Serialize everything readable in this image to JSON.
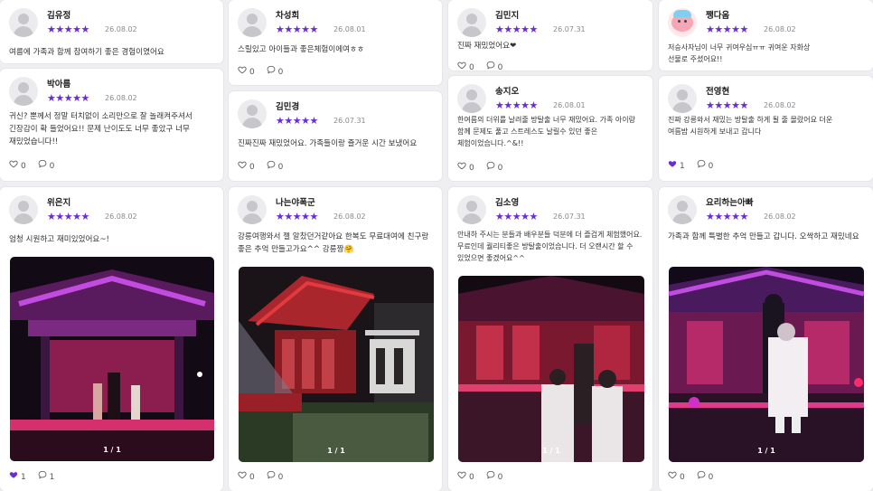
{
  "icons": {
    "like": "heart-icon",
    "comment": "comment-icon"
  },
  "colors": {
    "star": "#6a2bd9",
    "liked": "#6a2bd9",
    "background": "#efeff2"
  },
  "rating_stars": "★★★★★",
  "reviews": [
    {
      "name": "김유정",
      "date": "26.08.02",
      "text": "여름에 가족과 함께 참여하기 좋은 경험이였어요",
      "likes": "0",
      "comments": "0"
    },
    {
      "name": "박아름",
      "date": "26.08.02",
      "text": "귀신? 뿐께서 정말 터치없이 소리만으로 잘 놀래켜주셔서 긴장감이 확 들었어요!! 문제 난이도도 너무 좋았구 너무 재밌었습니다!!",
      "likes": "0",
      "comments": "0"
    },
    {
      "name": "위은지",
      "date": "26.08.02",
      "text": "엄청 시원하고 재미있었어요~!",
      "likes": "1",
      "comments": "1",
      "pager": "1 / 1"
    },
    {
      "name": "차성희",
      "date": "26.08.01",
      "text": "스릴있고 아이들과 좋은체험이에여ㅎㅎ",
      "likes": "0",
      "comments": "0"
    },
    {
      "name": "김민경",
      "date": "26.07.31",
      "text": "진짜진짜 재밌었어요. 가족들이랑 즐거운 시간 보냈어요",
      "likes": "0",
      "comments": "0"
    },
    {
      "name": "나는야폭군",
      "date": "26.08.02",
      "text": "강릉여행와서 젤 알찼던거같아요 한복도 무료대여에 친구랑 좋은 추억 만들고가요^^ 강릉짱🤗",
      "likes": "0",
      "comments": "0",
      "pager": "1 / 1"
    },
    {
      "name": "김민지",
      "date": "26.07.31",
      "text": "진짜 재밌었어요❤",
      "likes": "0",
      "comments": "0"
    },
    {
      "name": "송지오",
      "date": "26.08.01",
      "text": "한여름의 더위를 날려줄 방탈출 너무 재밌어요. 가족 아이랑 함께 문제도 풀고 스트레스도 날릴수 있던 좋은 체험이었습니다.^&!!",
      "likes": "0",
      "comments": "0"
    },
    {
      "name": "김소영",
      "date": "26.07.31",
      "text": "안내하 주시는 분들과 배우분들 덕분에 더 즐겁게 체험했어요. 무료인데 퀄리티좋은 방탈출이었습니다. 더 오랜시간 할 수 있었으면 좋겠어요^^",
      "likes": "0",
      "comments": "0",
      "pager": "1 / 1"
    },
    {
      "name": "쨍다옴",
      "date": "26.08.02",
      "text": "저승사자님이 너무 귀여우심ㅠㅠ 귀여운 자화상 선물로 주셨어요!!",
      "likes": "",
      "comments": ""
    },
    {
      "name": "전영현",
      "date": "26.08.02",
      "text": "진짜 강릉와서 재밌는 방탈출 하게 될 줄 몰랐어요 더운 여름밤 시원하게 보내고 갑니다",
      "likes": "1",
      "comments": "0"
    },
    {
      "name": "요리하는아빠",
      "date": "26.08.02",
      "text": "가족과 함께 특별한 추억 만들고 갑니다. 오싹하고 재밌네요",
      "likes": "0",
      "comments": "0",
      "pager": "1 / 1"
    }
  ]
}
